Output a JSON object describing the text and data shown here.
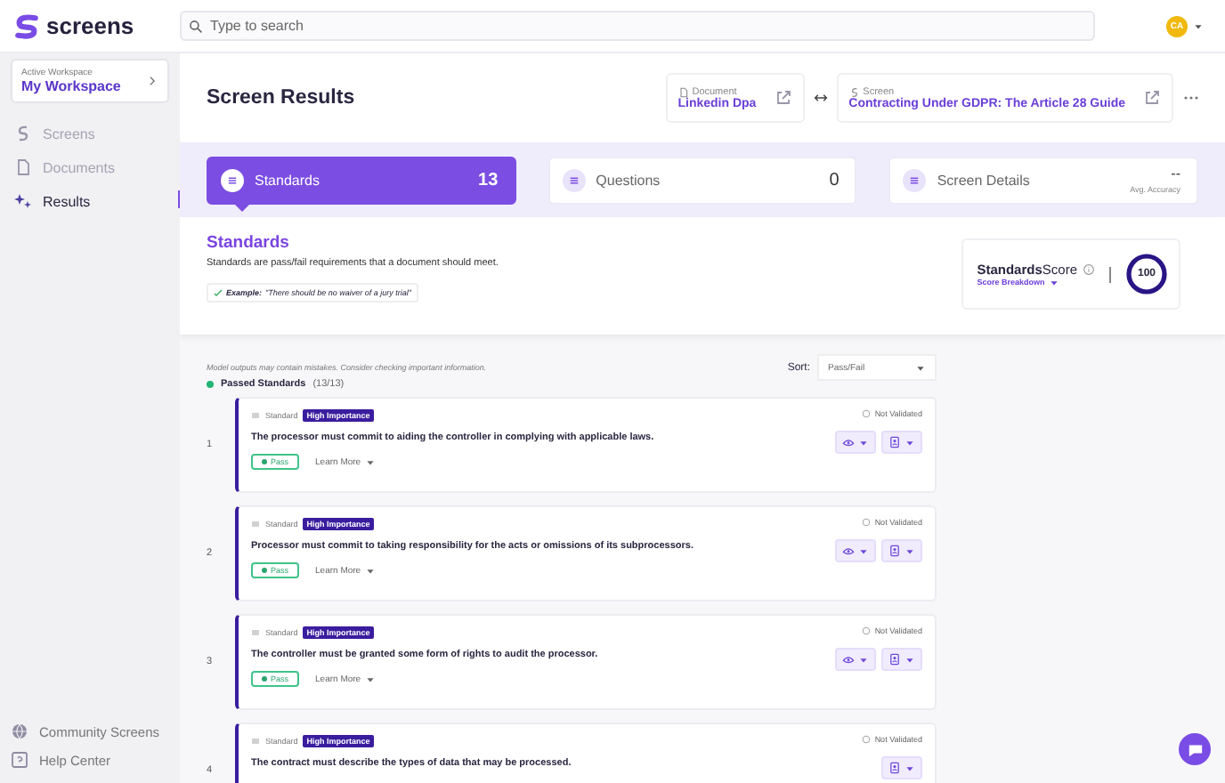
{
  "app": {
    "logo": "screens",
    "search": {
      "placeholder": "Type to search"
    },
    "avatar": "CA"
  },
  "sidebar": {
    "workspace": {
      "label": "Active Workspace",
      "name": "My Workspace"
    },
    "items": [
      {
        "label": "Screens",
        "selected": false
      },
      {
        "label": "Documents",
        "selected": false
      },
      {
        "label": "Results",
        "selected": true
      }
    ],
    "footer": [
      {
        "label": "Community Screens"
      },
      {
        "label": "Help Center"
      }
    ]
  },
  "header": {
    "title": "Screen Results",
    "document": {
      "label": "Document",
      "name": "Linkedin Dpa"
    },
    "screen": {
      "label": "Screen",
      "name": "Contracting Under GDPR: The Article 28 Guide"
    }
  },
  "tabs": [
    {
      "kind": "count",
      "label": "Standards",
      "value": "13",
      "selected": true
    },
    {
      "kind": "count",
      "label": "Questions",
      "value": "0",
      "selected": false
    },
    {
      "kind": "accuracy",
      "label": "Screen Details",
      "value": "--",
      "caption": "Avg. Accuracy",
      "selected": false
    }
  ],
  "intro": {
    "title": "Standards",
    "description": "Standards are pass/fail requirements that a document should meet.",
    "example_label": "Example:",
    "example_text": "\"There should be no waiver of a jury trial\""
  },
  "score": {
    "title_bold": "Standards",
    "title": "Score",
    "link": "Score Breakdown",
    "value": "100",
    "level": 1
  },
  "results": {
    "disclaimer": "Model outputs may contain mistakes. Consider checking important information.",
    "sort": {
      "label": "Sort:",
      "value": "Pass/Fail"
    },
    "group": {
      "label": "Passed Standards",
      "count": "(13/13)",
      "color": "#22b573"
    },
    "items": [
      {
        "number": "1",
        "type": "Standard",
        "importance": "High Importance",
        "text": "The processor must commit to aiding the controller in complying with applicable laws.",
        "status": "Pass",
        "learn": "Learn More",
        "validation": "Not Validated",
        "actions": [
          {
            "kind": "view"
          },
          {
            "kind": "reviewer"
          }
        ]
      },
      {
        "number": "2",
        "type": "Standard",
        "importance": "High Importance",
        "text": "Processor must commit to taking responsibility for the acts or omissions of its subprocessors.",
        "status": "Pass",
        "learn": "Learn More",
        "validation": "Not Validated",
        "actions": [
          {
            "kind": "view"
          },
          {
            "kind": "reviewer"
          }
        ]
      },
      {
        "number": "3",
        "type": "Standard",
        "importance": "High Importance",
        "text": "The controller must be granted some form of rights to audit the processor.",
        "status": "Pass",
        "learn": "Learn More",
        "validation": "Not Validated",
        "actions": [
          {
            "kind": "view"
          },
          {
            "kind": "reviewer"
          }
        ]
      },
      {
        "number": "4",
        "type": "Standard",
        "importance": "High Importance",
        "text": "The contract must describe the types of data that may be processed.",
        "validation": "Not Validated",
        "actions": [
          {
            "kind": "reviewer"
          }
        ]
      }
    ]
  }
}
